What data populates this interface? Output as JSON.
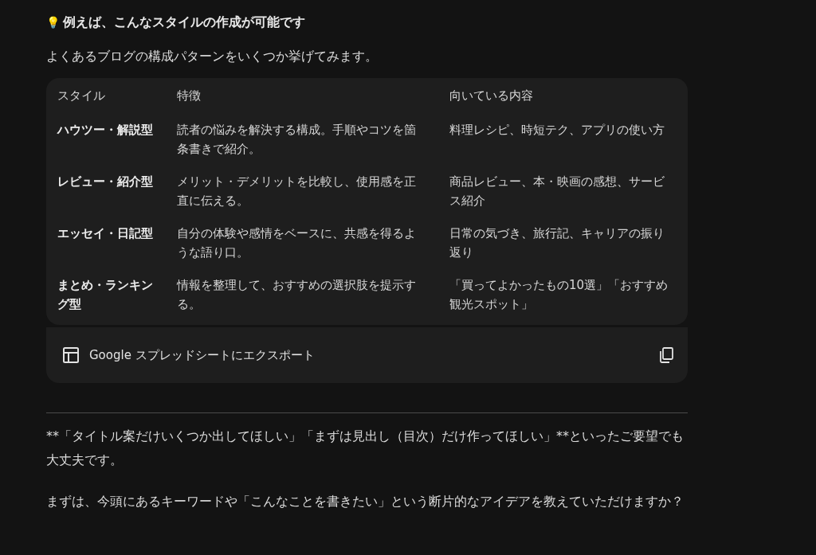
{
  "heading": {
    "emoji": "💡",
    "text": "例えば、こんなスタイルの作成が可能です"
  },
  "intro": "よくあるブログの構成パターンをいくつか挙げてみます。",
  "table": {
    "columns": [
      "スタイル",
      "特徴",
      "向いている内容"
    ],
    "rows": [
      [
        "ハウツー・解説型",
        "読者の悩みを解決する構成。手順やコツを箇条書きで紹介。",
        "料理レシピ、時短テク、アプリの使い方"
      ],
      [
        "レビュー・紹介型",
        "メリット・デメリットを比較し、使用感を正直に伝える。",
        "商品レビュー、本・映画の感想、サービス紹介"
      ],
      [
        "エッセイ・日記型",
        "自分の体験や感情をベースに、共感を得るような語り口。",
        "日常の気づき、旅行記、キャリアの振り返り"
      ],
      [
        "まとめ・ランキング型",
        "情報を整理して、おすすめの選択肢を提示する。",
        "「買ってよかったもの10選」「おすすめ観光スポット」"
      ]
    ],
    "export_label": "Google スプレッドシートにエクスポート"
  },
  "paragraphs": [
    "**「タイトル案だけいくつか出してほしい」「まずは見出し（目次）だけ作ってほしい」**といったご要望でも大丈夫です。",
    "まずは、今頭にあるキーワードや「こんなことを書きたい」という断片的なアイデアを教えていただけますか？"
  ]
}
